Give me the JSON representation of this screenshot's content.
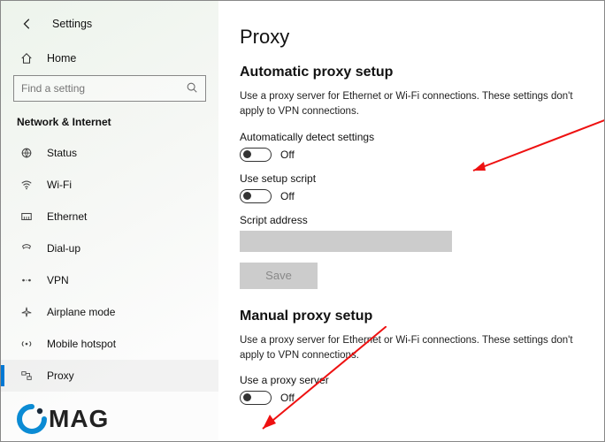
{
  "header": {
    "title": "Settings"
  },
  "home": {
    "label": "Home"
  },
  "search": {
    "placeholder": "Find a setting"
  },
  "section": {
    "title": "Network & Internet"
  },
  "menu": [
    {
      "label": "Status"
    },
    {
      "label": "Wi-Fi"
    },
    {
      "label": "Ethernet"
    },
    {
      "label": "Dial-up"
    },
    {
      "label": "VPN"
    },
    {
      "label": "Airplane mode"
    },
    {
      "label": "Mobile hotspot"
    },
    {
      "label": "Proxy"
    }
  ],
  "main": {
    "title": "Proxy",
    "auto": {
      "heading": "Automatic proxy setup",
      "desc": "Use a proxy server for Ethernet or Wi-Fi connections. These settings don't apply to VPN connections.",
      "detect_label": "Automatically detect settings",
      "detect_state": "Off",
      "script_label": "Use setup script",
      "script_state": "Off",
      "script_addr_label": "Script address",
      "save_label": "Save"
    },
    "manual": {
      "heading": "Manual proxy setup",
      "desc": "Use a proxy server for Ethernet or Wi-Fi connections. These settings don't apply to VPN connections.",
      "use_label": "Use a proxy server",
      "use_state": "Off"
    }
  },
  "logo": {
    "text": "MAG"
  }
}
